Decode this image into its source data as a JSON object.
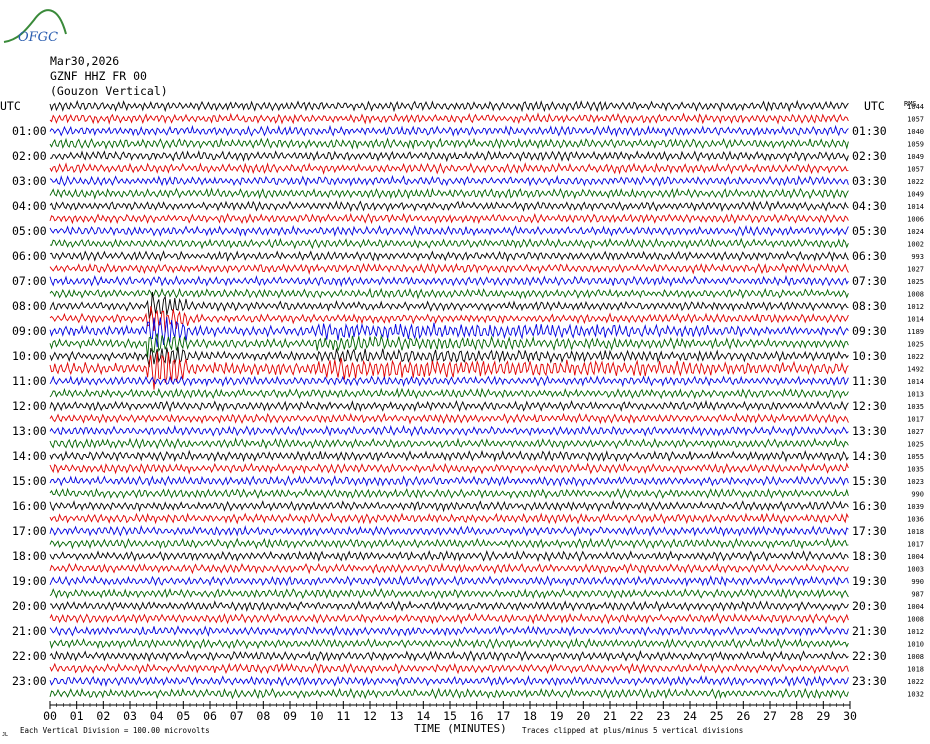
{
  "logo": {
    "text": "OFGC"
  },
  "header": {
    "date": "Mar30,2026",
    "station": "GZNF HHZ FR 00",
    "site": "(Gouzon Vertical)"
  },
  "axes": {
    "left_label": "UTC",
    "right_label": "UTC",
    "rms_label": "RMS",
    "xlabel": "TIME (MINUTES)",
    "x_ticks": [
      "00",
      "01",
      "02",
      "03",
      "04",
      "05",
      "06",
      "07",
      "08",
      "09",
      "10",
      "11",
      "12",
      "13",
      "14",
      "15",
      "16",
      "17",
      "18",
      "19",
      "20",
      "21",
      "22",
      "23",
      "24",
      "25",
      "26",
      "27",
      "28",
      "29",
      "30"
    ]
  },
  "footer": {
    "scale_note": "Each Vertical Division =  100.00 microvolts",
    "clip_note": "Traces clipped at plus/minus 5 vertical divisions",
    "corner_mark": "JL"
  },
  "colors": {
    "cycle": [
      "#000000",
      "#e00000",
      "#0000e0",
      "#006400"
    ]
  },
  "chart_data": {
    "type": "helicorder",
    "title": "Mar30,2026 GZNF HHZ FR 00 (Gouzon Vertical)",
    "xlabel": "TIME (MINUTES)",
    "xlim": [
      0,
      30
    ],
    "trace_minutes": 30,
    "left_hour_labels": [
      "01:00",
      "02:00",
      "03:00",
      "04:00",
      "05:00",
      "06:00",
      "07:00",
      "08:00",
      "09:00",
      "10:00",
      "11:00",
      "12:00",
      "13:00",
      "14:00",
      "15:00",
      "16:00",
      "17:00",
      "18:00",
      "19:00",
      "20:00",
      "21:00",
      "22:00",
      "23:00"
    ],
    "right_hour_labels": [
      "01:30",
      "02:30",
      "03:30",
      "04:30",
      "05:30",
      "06:30",
      "07:30",
      "08:30",
      "09:30",
      "10:30",
      "11:30",
      "12:30",
      "13:30",
      "14:30",
      "15:30",
      "16:30",
      "17:30",
      "18:30",
      "19:30",
      "20:30",
      "21:30",
      "22:30",
      "23:30"
    ],
    "rms": [
      1044,
      1057,
      1040,
      1059,
      1049,
      1057,
      1022,
      1049,
      1014,
      1006,
      1024,
      1002,
      993,
      1027,
      1025,
      1008,
      1012,
      1014,
      1189,
      1025,
      1022,
      1492,
      1014,
      1013,
      1035,
      1017,
      1027,
      1025,
      1055,
      1035,
      1023,
      990,
      1039,
      1036,
      1018,
      1017,
      1004,
      1003,
      990,
      987,
      1004,
      1008,
      1012,
      1010,
      1008,
      1018,
      1022,
      1032
    ],
    "events": [
      {
        "start_minute": 3.6,
        "end_minute": 5.2,
        "first_trace": 16,
        "last_trace": 21,
        "relative_amplitude": 4.0
      },
      {
        "start_minute": 10.0,
        "end_minute": 30.0,
        "first_trace": 18,
        "last_trace": 21,
        "relative_amplitude": 1.8
      }
    ],
    "clip_divisions": 5,
    "division_microvolts": 100.0
  }
}
